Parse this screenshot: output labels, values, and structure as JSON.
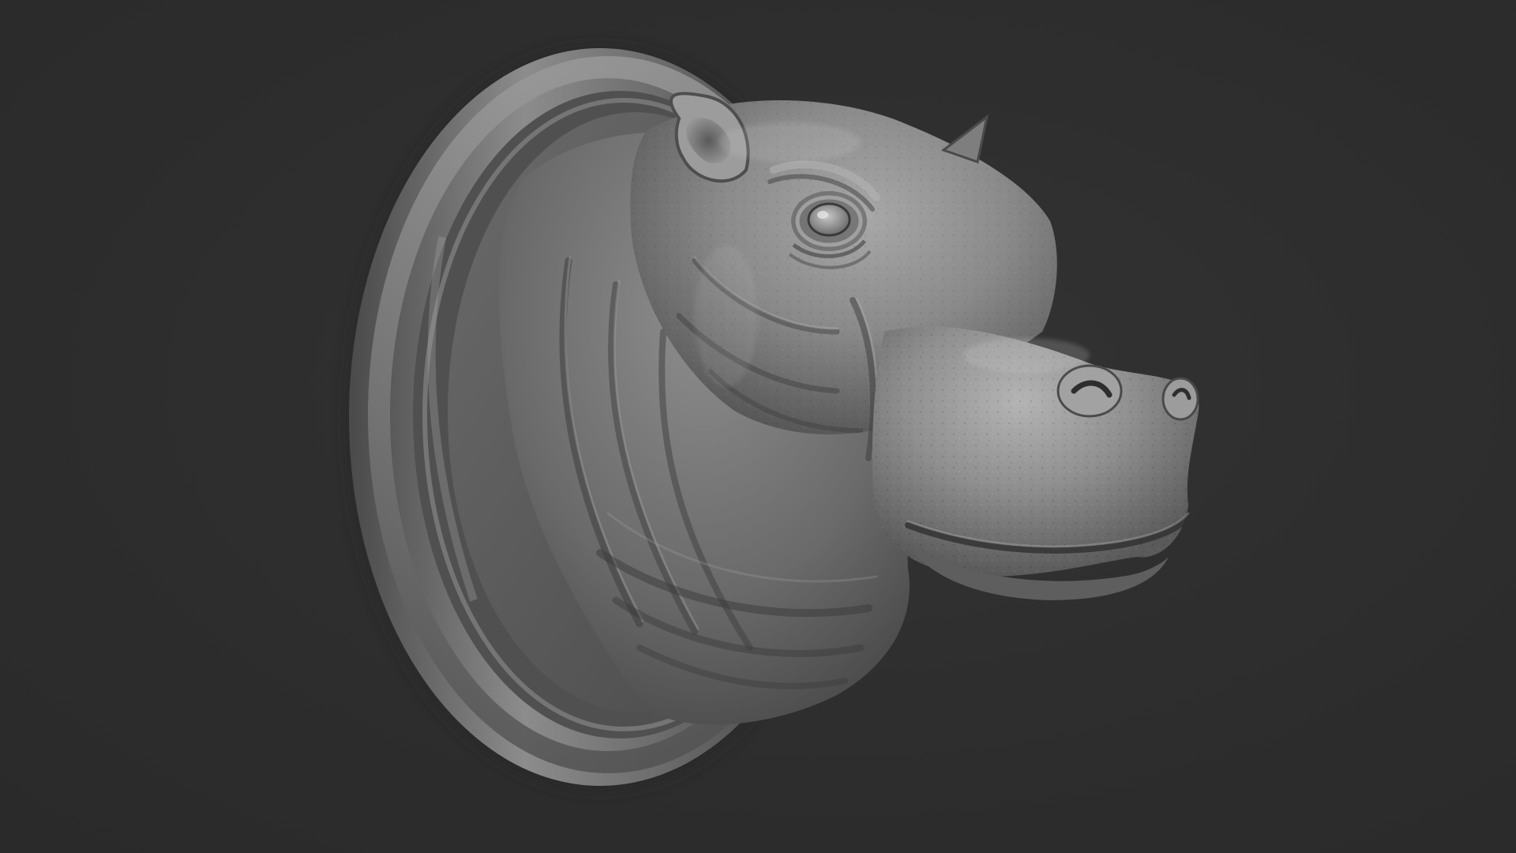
{
  "scene": {
    "subject": "hippo-head-plaque-sculpt",
    "background_color": "#2e2e2e",
    "material_color": "#8a8a8a"
  }
}
